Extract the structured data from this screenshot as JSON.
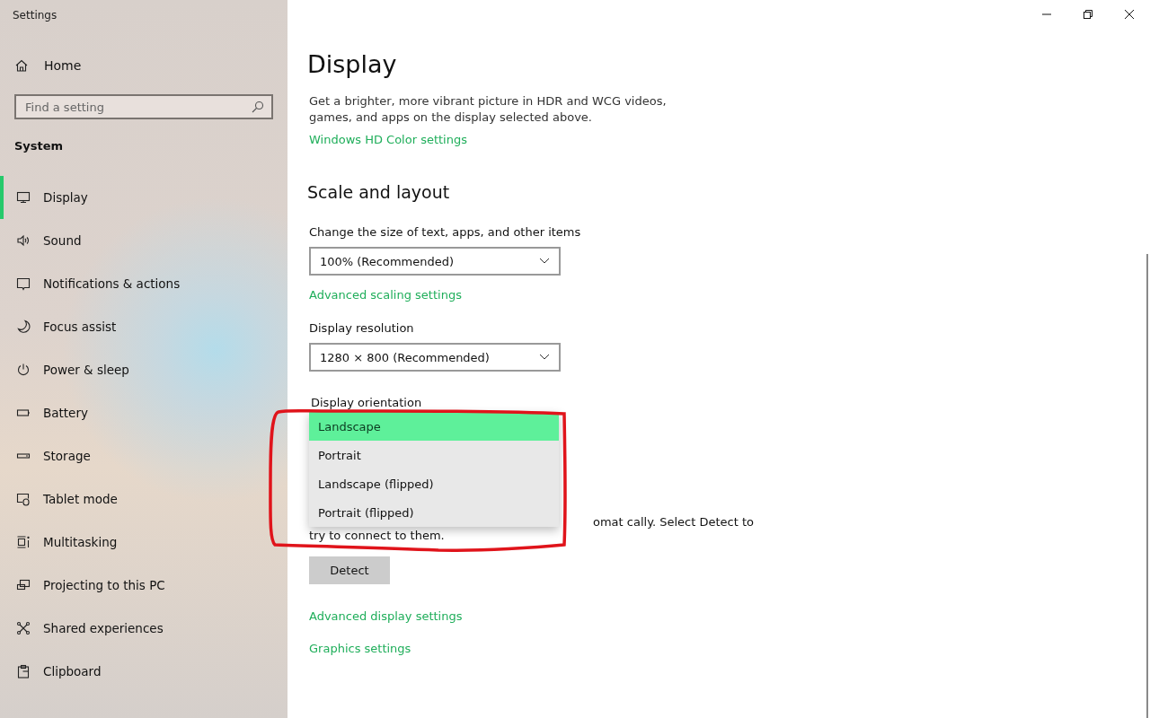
{
  "window": {
    "title": "Settings"
  },
  "sidebar": {
    "home": "Home",
    "search": {
      "placeholder": "Find a setting"
    },
    "section": "System",
    "items": [
      {
        "label": "Display",
        "selected": true
      },
      {
        "label": "Sound",
        "selected": false
      },
      {
        "label": "Notifications & actions",
        "selected": false
      },
      {
        "label": "Focus assist",
        "selected": false
      },
      {
        "label": "Power & sleep",
        "selected": false
      },
      {
        "label": "Battery",
        "selected": false
      },
      {
        "label": "Storage",
        "selected": false
      },
      {
        "label": "Tablet mode",
        "selected": false
      },
      {
        "label": "Multitasking",
        "selected": false
      },
      {
        "label": "Projecting to this PC",
        "selected": false
      },
      {
        "label": "Shared experiences",
        "selected": false
      },
      {
        "label": "Clipboard",
        "selected": false
      }
    ]
  },
  "content": {
    "title": "Display",
    "hdr_text": "Get a brighter, more vibrant picture in HDR and WCG videos, games, and apps on the display selected above.",
    "hdr_link": "Windows HD Color settings",
    "scale_heading": "Scale and layout",
    "scale_label": "Change the size of text, apps, and other items",
    "scale_value": "100% (Recommended)",
    "scaling_link": "Advanced scaling settings",
    "resolution_label": "Display resolution",
    "resolution_value": "1280 × 800 (Recommended)",
    "orientation_label": "Display orientation",
    "orientation_options": [
      {
        "label": "Landscape",
        "selected": true
      },
      {
        "label": "Portrait",
        "selected": false
      },
      {
        "label": "Landscape (flipped)",
        "selected": false
      },
      {
        "label": "Portrait (flipped)",
        "selected": false
      }
    ],
    "detect_text_line_1": "omat cally. Select Detect to",
    "detect_text_line_2": "try to connect to them.",
    "detect_button": "Detect",
    "links": [
      "Advanced display settings",
      "Graphics settings"
    ]
  }
}
